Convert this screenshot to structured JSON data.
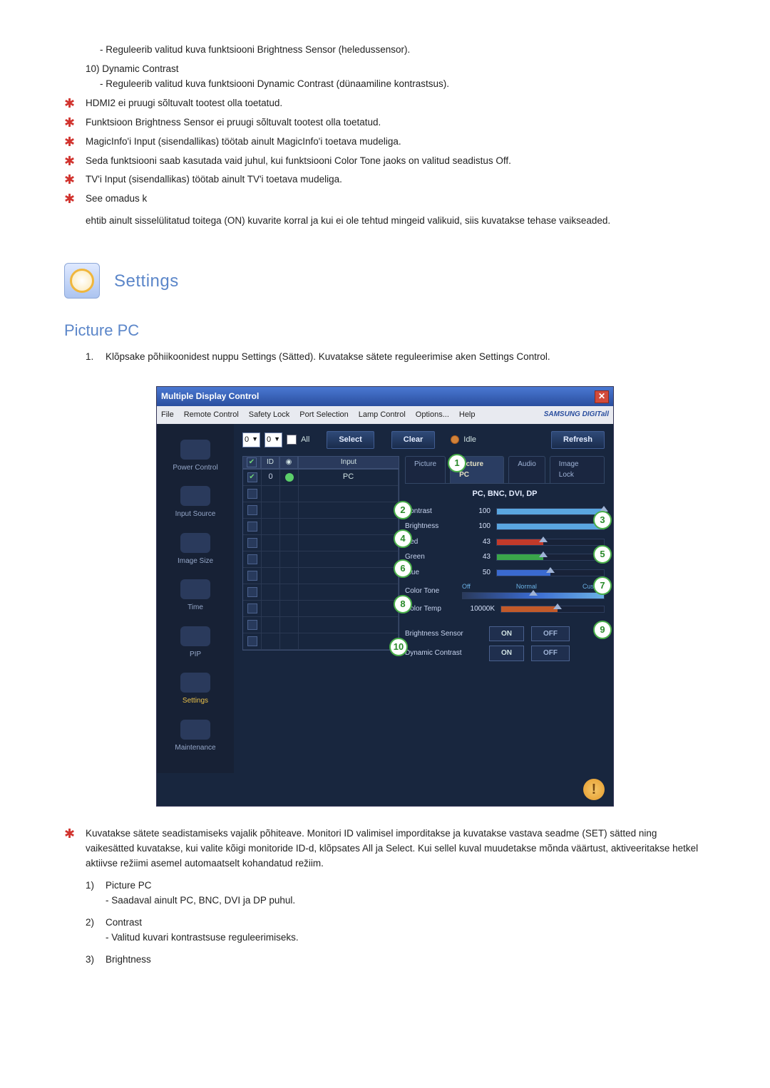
{
  "top": {
    "item9_desc": "- Reguleerib valitud kuva funktsiooni Brightness Sensor (heledussensor).",
    "item10_label": "10) Dynamic Contrast",
    "item10_desc": "- Reguleerib valitud kuva funktsiooni Dynamic Contrast (dünaamiline kontrastsus)."
  },
  "notes": [
    "HDMI2 ei pruugi sõltuvalt tootest olla toetatud.",
    "Funktsioon Brightness Sensor ei pruugi sõltuvalt tootest olla toetatud.",
    "MagicInfo'i Input (sisendallikas) töötab ainult MagicInfo'i toetava mudeliga.",
    "Seda funktsiooni saab kasutada vaid juhul, kui funktsiooni Color Tone jaoks on valitud seadistus Off.",
    "TV'i Input (sisendallikas) töötab ainult TV'i toetava mudeliga.",
    "See omadus k"
  ],
  "notes_tail": "ehtib ainult sisselülitatud toitega (ON) kuvarite korral ja kui ei ole tehtud mingeid valikuid, siis kuvatakse tehase vaikseaded.",
  "heading": "Settings",
  "section": "Picture PC",
  "intro_num": "1.",
  "intro": "Klõpsake põhiikoonidest nuppu Settings (Sätted). Kuvatakse sätete reguleerimise aken Settings Control.",
  "app": {
    "title": "Multiple Display Control",
    "menus": [
      "File",
      "Remote Control",
      "Safety Lock",
      "Port Selection",
      "Lamp Control",
      "Options...",
      "Help"
    ],
    "brand": "SAMSUNG DIGITall",
    "combo_a": "0",
    "combo_b": "0",
    "all": "All",
    "select": "Select",
    "clear": "Clear",
    "idle": "Idle",
    "refresh": "Refresh",
    "sidebar": [
      {
        "label": "Power Control"
      },
      {
        "label": "Input Source"
      },
      {
        "label": "Image Size"
      },
      {
        "label": "Time"
      },
      {
        "label": "PIP"
      },
      {
        "label": "Settings"
      },
      {
        "label": "Maintenance"
      }
    ],
    "grid_headers": [
      "",
      "ID",
      "",
      "Input"
    ],
    "grid_first_id": "0",
    "grid_first_input": "PC",
    "tabs": [
      "Picture",
      "Picture PC",
      "Audio",
      "Image Lock"
    ],
    "panel_heading": "PC, BNC, DVI, DP",
    "rows": {
      "contrast": {
        "label": "Contrast",
        "val": "100"
      },
      "brightness": {
        "label": "Brightness",
        "val": "100"
      },
      "red": {
        "label": "Red",
        "val": "43"
      },
      "green": {
        "label": "Green",
        "val": "43"
      },
      "blue": {
        "label": "Blue",
        "val": "50"
      },
      "colortone": {
        "label": "Color Tone",
        "off": "Off",
        "normal": "Normal",
        "custom": "Custom"
      },
      "colortemp": {
        "label": "Color Temp",
        "val": "10000K"
      },
      "bsensor": {
        "label": "Brightness Sensor",
        "on": "ON",
        "off": "OFF"
      },
      "dcontrast": {
        "label": "Dynamic Contrast",
        "on": "ON",
        "off": "OFF"
      }
    }
  },
  "post_note": "Kuvatakse sätete seadistamiseks vajalik põhiteave. Monitori ID valimisel imporditakse ja kuvatakse vastava seadme (SET) sätted ning vaikesätted kuvatakse, kui valite kõigi monitoride ID-d, klõpsates All ja Select. Kui sellel kuval muudetakse mõnda väärtust, aktiveeritakse hetkel aktiivse režiimi asemel automaatselt kohandatud režiim.",
  "defs": [
    {
      "n": "1)",
      "label": "Picture PC",
      "desc": "- Saadaval ainult PC, BNC, DVI ja DP puhul."
    },
    {
      "n": "2)",
      "label": "Contrast",
      "desc": "- Valitud kuvari kontrastsuse reguleerimiseks."
    },
    {
      "n": "3)",
      "label": "Brightness",
      "desc": ""
    }
  ]
}
